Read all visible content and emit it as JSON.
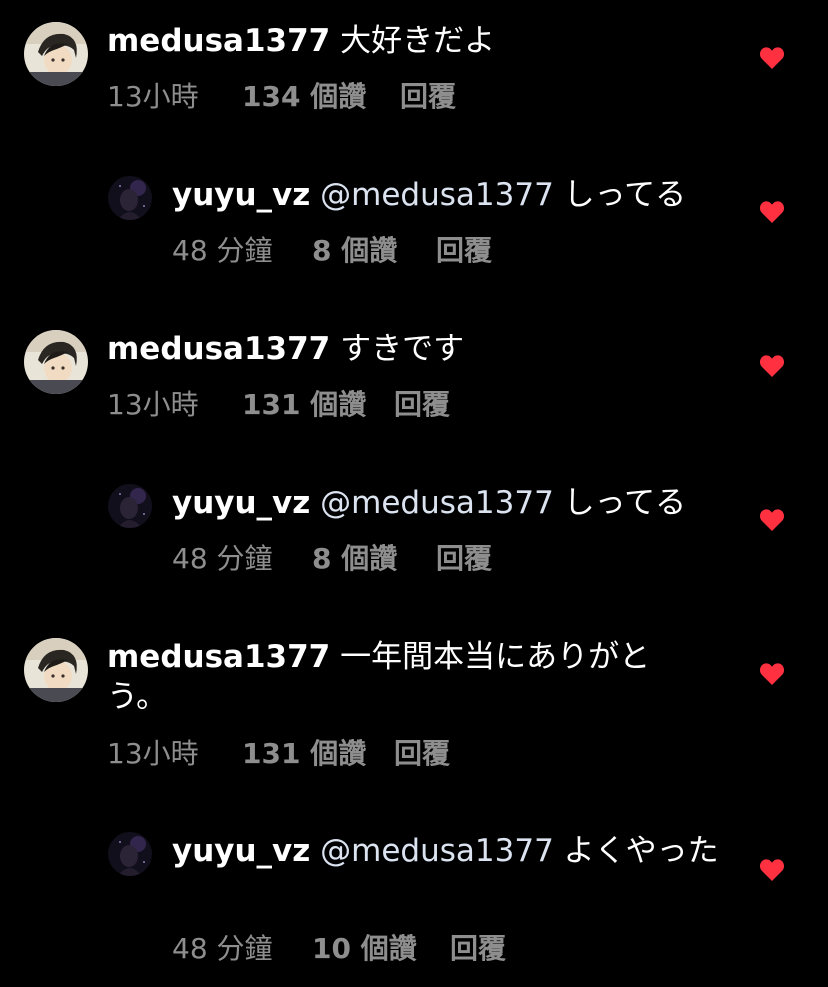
{
  "colors": {
    "background": "#000000",
    "text": "#ffffff",
    "meta": "#8e8e8e",
    "heart": "#ff3040"
  },
  "comments": [
    {
      "username": "medusa1377",
      "mention": "",
      "body": " 大好きだよ",
      "time": "13小時",
      "likes": "134 個讚",
      "reply": "回覆",
      "liked": true
    },
    {
      "username": "yuyu_vz",
      "mention": " @medusa1377",
      "body": " しってる",
      "time": "48 分鐘",
      "likes": "8 個讚",
      "reply": "回覆",
      "liked": true
    },
    {
      "username": "medusa1377",
      "mention": "",
      "body": " すきです",
      "time": "13小時",
      "likes": "131 個讚",
      "reply": "回覆",
      "liked": true
    },
    {
      "username": "yuyu_vz",
      "mention": " @medusa1377",
      "body": " しってる",
      "time": "48 分鐘",
      "likes": "8 個讚",
      "reply": "回覆",
      "liked": true
    },
    {
      "username": "medusa1377",
      "mention": "",
      "body": " 一年間本当にありがとう。",
      "time": "13小時",
      "likes": "131 個讚",
      "reply": "回覆",
      "liked": true
    },
    {
      "username": "yuyu_vz",
      "mention": " @medusa1377",
      "body": " よくやった",
      "time": "48 分鐘",
      "likes": "10 個讚",
      "reply": "回覆",
      "liked": true
    }
  ]
}
